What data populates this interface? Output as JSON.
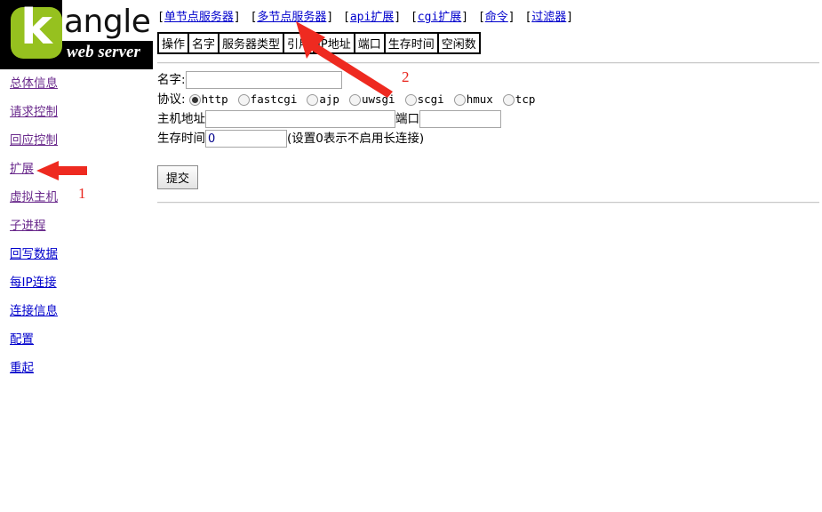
{
  "logo": {
    "mark_letter": "k",
    "wordmark": "angle",
    "tagline": "web server",
    "accent_color": "#96c11f",
    "bar_color": "#000000"
  },
  "sidebar": {
    "items": [
      {
        "label": "总体信息",
        "state": "visited"
      },
      {
        "label": "请求控制",
        "state": "visited"
      },
      {
        "label": "回应控制",
        "state": "visited"
      },
      {
        "label": "扩展",
        "state": "visited"
      },
      {
        "label": "虚拟主机",
        "state": "visited"
      },
      {
        "label": "子进程",
        "state": "visited"
      },
      {
        "label": "回写数据",
        "state": "link"
      },
      {
        "label": "每IP连接",
        "state": "link"
      },
      {
        "label": "连接信息",
        "state": "link"
      },
      {
        "label": "配置",
        "state": "link"
      },
      {
        "label": "重起",
        "state": "link"
      }
    ],
    "link_color": "#0000cc",
    "visited_color": "#6a2a8c"
  },
  "topnav": {
    "links": [
      "单节点服务器",
      "多节点服务器",
      "api扩展",
      "cgi扩展",
      "命令",
      "过滤器"
    ],
    "open_bracket": "[",
    "close_bracket": "]"
  },
  "tabs_table": {
    "headers": [
      "操作",
      "名字",
      "服务器类型",
      "引用",
      "IP地址",
      "端口",
      "生存时间",
      "空闲数"
    ]
  },
  "form": {
    "name_label": "名字:",
    "name_value": "",
    "protocol_label": "协议:",
    "protocols": [
      {
        "label": "http",
        "checked": true
      },
      {
        "label": "fastcgi",
        "checked": false
      },
      {
        "label": "ajp",
        "checked": false
      },
      {
        "label": "uwsgi",
        "checked": false
      },
      {
        "label": "scgi",
        "checked": false
      },
      {
        "label": "hmux",
        "checked": false
      },
      {
        "label": "tcp",
        "checked": false
      }
    ],
    "host_label": "主机地址",
    "host_value": "",
    "port_label": "端口",
    "port_value": "",
    "ttl_label": "生存时间",
    "ttl_value": "0",
    "ttl_hint": "(设置0表示不启用长连接)",
    "submit_label": "提交"
  },
  "annotations": {
    "color": "#e8241c",
    "marker_1": "1",
    "marker_2": "2"
  }
}
